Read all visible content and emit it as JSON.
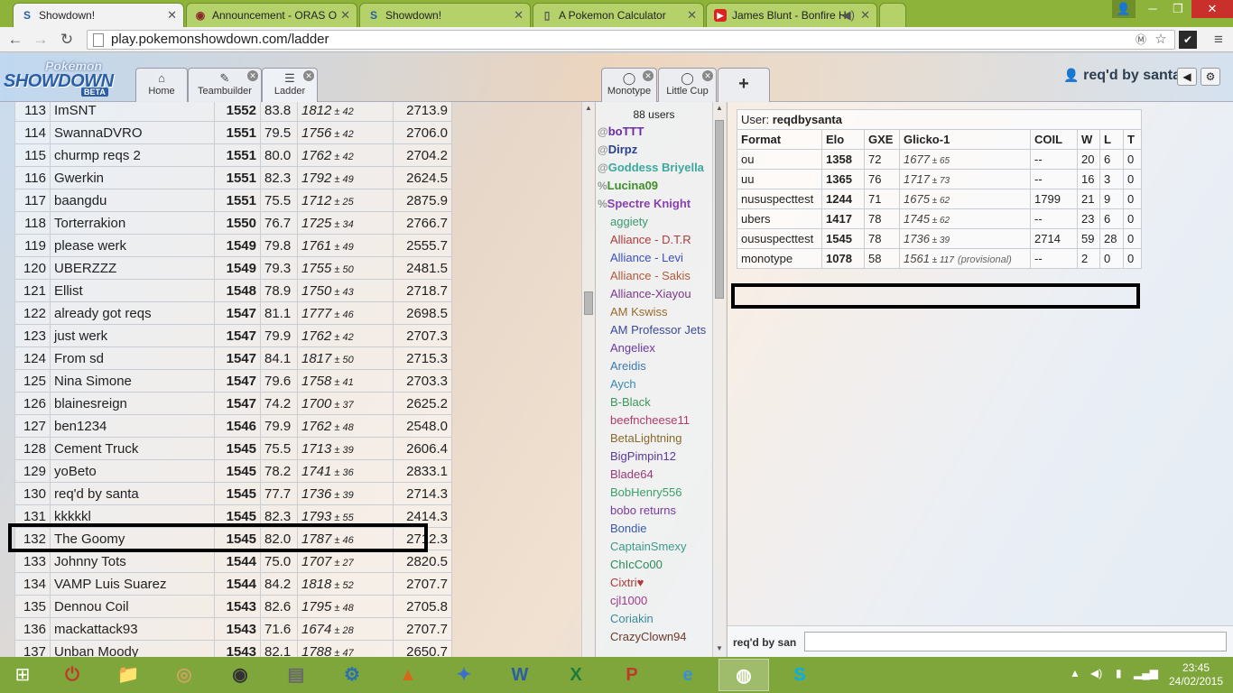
{
  "browser": {
    "tabs": [
      {
        "title": "Showdown!",
        "icon": "S",
        "icon_name": "showdown-favicon"
      },
      {
        "title": "Announcement - ORAS O",
        "icon": "◉",
        "icon_name": "smogon-favicon"
      },
      {
        "title": "Showdown!",
        "icon": "S",
        "icon_name": "showdown-favicon"
      },
      {
        "title": "A Pokemon Calculator",
        "icon": "▯",
        "icon_name": "page-favicon"
      },
      {
        "title": "James Blunt - Bonfire H",
        "icon": "▶",
        "icon_name": "youtube-favicon"
      }
    ],
    "url": "play.pokemonshowdown.com/ladder"
  },
  "showdown": {
    "logo_top": "Pokémon",
    "logo_main": "SHOWDOWN",
    "logo_badge": "BETA",
    "tabs": [
      {
        "label": "Home",
        "icon": "⌂"
      },
      {
        "label": "Teambuilder",
        "icon": "✎"
      },
      {
        "label": "Ladder",
        "icon": "☰"
      }
    ],
    "room_tabs": [
      {
        "label": "Monotype",
        "icon": "💬"
      },
      {
        "label": "Little Cup",
        "icon": "💬"
      },
      {
        "label": "+"
      }
    ],
    "username": "req'd by santa"
  },
  "ladder": {
    "partial_row": {
      "rank": "113",
      "name": "ImSNT",
      "elo": "1552",
      "gxe": "83.8",
      "glicko": "1812",
      "dev": "42",
      "coil": "2713.9"
    },
    "rows": [
      {
        "rank": "114",
        "name": "SwannaDVRO",
        "elo": "1551",
        "gxe": "79.5",
        "glicko": "1756",
        "dev": "42",
        "coil": "2706.0"
      },
      {
        "rank": "115",
        "name": "churmp reqs 2",
        "elo": "1551",
        "gxe": "80.0",
        "glicko": "1762",
        "dev": "42",
        "coil": "2704.2"
      },
      {
        "rank": "116",
        "name": "Gwerkin",
        "elo": "1551",
        "gxe": "82.3",
        "glicko": "1792",
        "dev": "49",
        "coil": "2624.5"
      },
      {
        "rank": "117",
        "name": "baangdu",
        "elo": "1551",
        "gxe": "75.5",
        "glicko": "1712",
        "dev": "25",
        "coil": "2875.9"
      },
      {
        "rank": "118",
        "name": "Torterrakion",
        "elo": "1550",
        "gxe": "76.7",
        "glicko": "1725",
        "dev": "34",
        "coil": "2766.7"
      },
      {
        "rank": "119",
        "name": "please werk",
        "elo": "1549",
        "gxe": "79.8",
        "glicko": "1761",
        "dev": "49",
        "coil": "2555.7"
      },
      {
        "rank": "120",
        "name": "UBERZZZ",
        "elo": "1549",
        "gxe": "79.3",
        "glicko": "1755",
        "dev": "50",
        "coil": "2481.5"
      },
      {
        "rank": "121",
        "name": "Ellist",
        "elo": "1548",
        "gxe": "78.9",
        "glicko": "1750",
        "dev": "43",
        "coil": "2718.7"
      },
      {
        "rank": "122",
        "name": "already got reqs",
        "elo": "1547",
        "gxe": "81.1",
        "glicko": "1777",
        "dev": "46",
        "coil": "2698.5"
      },
      {
        "rank": "123",
        "name": "just werk",
        "elo": "1547",
        "gxe": "79.9",
        "glicko": "1762",
        "dev": "42",
        "coil": "2707.3"
      },
      {
        "rank": "124",
        "name": "From sd",
        "elo": "1547",
        "gxe": "84.1",
        "glicko": "1817",
        "dev": "50",
        "coil": "2715.3"
      },
      {
        "rank": "125",
        "name": "Nina Simone",
        "elo": "1547",
        "gxe": "79.6",
        "glicko": "1758",
        "dev": "41",
        "coil": "2703.3"
      },
      {
        "rank": "126",
        "name": "blainesreign",
        "elo": "1547",
        "gxe": "74.2",
        "glicko": "1700",
        "dev": "37",
        "coil": "2625.2"
      },
      {
        "rank": "127",
        "name": "ben1234",
        "elo": "1546",
        "gxe": "79.9",
        "glicko": "1762",
        "dev": "48",
        "coil": "2548.0"
      },
      {
        "rank": "128",
        "name": "Cement Truck",
        "elo": "1545",
        "gxe": "75.5",
        "glicko": "1713",
        "dev": "39",
        "coil": "2606.4"
      },
      {
        "rank": "129",
        "name": "yoBeto",
        "elo": "1545",
        "gxe": "78.2",
        "glicko": "1741",
        "dev": "36",
        "coil": "2833.1"
      },
      {
        "rank": "130",
        "name": "req'd by santa",
        "elo": "1545",
        "gxe": "77.7",
        "glicko": "1736",
        "dev": "39",
        "coil": "2714.3"
      },
      {
        "rank": "131",
        "name": "kkkkkl",
        "elo": "1545",
        "gxe": "82.3",
        "glicko": "1793",
        "dev": "55",
        "coil": "2414.3"
      },
      {
        "rank": "132",
        "name": "The Goomy",
        "elo": "1545",
        "gxe": "82.0",
        "glicko": "1787",
        "dev": "46",
        "coil": "2712.3"
      },
      {
        "rank": "133",
        "name": "Johnny Tots",
        "elo": "1544",
        "gxe": "75.0",
        "glicko": "1707",
        "dev": "27",
        "coil": "2820.5"
      },
      {
        "rank": "134",
        "name": "VAMP Luis Suarez",
        "elo": "1544",
        "gxe": "84.2",
        "glicko": "1818",
        "dev": "52",
        "coil": "2707.7"
      },
      {
        "rank": "135",
        "name": "Dennou Coil",
        "elo": "1543",
        "gxe": "82.6",
        "glicko": "1795",
        "dev": "48",
        "coil": "2705.8"
      },
      {
        "rank": "136",
        "name": "mackattack93",
        "elo": "1543",
        "gxe": "71.6",
        "glicko": "1674",
        "dev": "28",
        "coil": "2707.7"
      },
      {
        "rank": "137",
        "name": "Unban Moody",
        "elo": "1543",
        "gxe": "82.1",
        "glicko": "1788",
        "dev": "47",
        "coil": "2650.7"
      }
    ]
  },
  "userlist": {
    "count": "88 users",
    "users": [
      {
        "rank": "@",
        "name": "boTTT",
        "color": "#6b2ca8"
      },
      {
        "rank": "@",
        "name": "Dirpz",
        "color": "#2a3f8f"
      },
      {
        "rank": "@",
        "name": "Goddess Briyella",
        "color": "#3aa8a0"
      },
      {
        "rank": "%",
        "name": "Lucina09",
        "color": "#3f8f2a"
      },
      {
        "rank": "%",
        "name": "Spectre Knight",
        "color": "#8a3fb0"
      },
      {
        "rank": "",
        "name": "aggiety",
        "color": "#3a9a6f"
      },
      {
        "rank": "",
        "name": "Alliance - D.T.R",
        "color": "#b03a3a"
      },
      {
        "rank": "",
        "name": "Alliance - Levi",
        "color": "#3a4fbf"
      },
      {
        "rank": "",
        "name": "Alliance - Sakis",
        "color": "#b05a3a"
      },
      {
        "rank": "",
        "name": "Alliance-Xiayou",
        "color": "#7a3a8a"
      },
      {
        "rank": "",
        "name": "AM Kswiss",
        "color": "#9a6a2a"
      },
      {
        "rank": "",
        "name": "AM Professor Jets",
        "color": "#3a4a9a"
      },
      {
        "rank": "",
        "name": "Angeliex",
        "color": "#6a3aa0"
      },
      {
        "rank": "",
        "name": "Areidis",
        "color": "#3a7ab0"
      },
      {
        "rank": "",
        "name": "Aych",
        "color": "#3a8ab0"
      },
      {
        "rank": "",
        "name": "B-Black",
        "color": "#3a9a5a"
      },
      {
        "rank": "",
        "name": "beefncheese11",
        "color": "#b03a6a"
      },
      {
        "rank": "",
        "name": "BetaLightning",
        "color": "#8a6a2a"
      },
      {
        "rank": "",
        "name": "BigPimpin12",
        "color": "#5a3a9a"
      },
      {
        "rank": "",
        "name": "Blade64",
        "color": "#9a3a7a"
      },
      {
        "rank": "",
        "name": "BobHenry556",
        "color": "#3aa06a"
      },
      {
        "rank": "",
        "name": "bobo returns",
        "color": "#7a3aa0"
      },
      {
        "rank": "",
        "name": "Bondie",
        "color": "#3a5ab0"
      },
      {
        "rank": "",
        "name": "CaptainSmexy",
        "color": "#3a9a8a"
      },
      {
        "rank": "",
        "name": "ChIcCo00",
        "color": "#2a8a5a"
      },
      {
        "rank": "",
        "name": "Cixtri♥",
        "color": "#b03a3a"
      },
      {
        "rank": "",
        "name": "cjl1000",
        "color": "#a03a8a"
      },
      {
        "rank": "",
        "name": "Coriakin",
        "color": "#3a8a9a"
      },
      {
        "rank": "",
        "name": "CrazyClown94",
        "color": "#6a3a2a"
      }
    ]
  },
  "userinfo": {
    "label": "User:",
    "username": "reqdbysanta",
    "headers": [
      "Format",
      "Elo",
      "GXE",
      "Glicko-1",
      "COIL",
      "W",
      "L",
      "T"
    ],
    "rows": [
      {
        "format": "ou",
        "elo": "1358",
        "gxe": "72",
        "glicko": "1677",
        "dev": "65",
        "note": "",
        "coil": "--",
        "w": "20",
        "l": "6",
        "t": "0"
      },
      {
        "format": "uu",
        "elo": "1365",
        "gxe": "76",
        "glicko": "1717",
        "dev": "73",
        "note": "",
        "coil": "--",
        "w": "16",
        "l": "3",
        "t": "0"
      },
      {
        "format": "nususpecttest",
        "elo": "1244",
        "gxe": "71",
        "glicko": "1675",
        "dev": "62",
        "note": "",
        "coil": "1799",
        "w": "21",
        "l": "9",
        "t": "0"
      },
      {
        "format": "ubers",
        "elo": "1417",
        "gxe": "78",
        "glicko": "1745",
        "dev": "62",
        "note": "",
        "coil": "--",
        "w": "23",
        "l": "6",
        "t": "0"
      },
      {
        "format": "oususpecttest",
        "elo": "1545",
        "gxe": "78",
        "glicko": "1736",
        "dev": "39",
        "note": "",
        "coil": "2714",
        "w": "59",
        "l": "28",
        "t": "0"
      },
      {
        "format": "monotype",
        "elo": "1078",
        "gxe": "58",
        "glicko": "1561",
        "dev": "117",
        "note": "(provisional)",
        "coil": "--",
        "w": "2",
        "l": "0",
        "t": "0"
      }
    ]
  },
  "chat": {
    "name": "req'd by san",
    "input_value": ""
  },
  "taskbar": {
    "time": "23:45",
    "date": "24/02/2015",
    "apps": [
      {
        "icon": "⏻",
        "name": "power-app-icon"
      },
      {
        "icon": "📁",
        "name": "file-explorer-icon"
      },
      {
        "icon": "◎",
        "name": "disc-app-icon"
      },
      {
        "icon": "◉",
        "name": "speaker-app-icon"
      },
      {
        "icon": "▤",
        "name": "document-app-icon"
      },
      {
        "icon": "⚙",
        "name": "settings-app-icon"
      },
      {
        "icon": "▲",
        "name": "matlab-icon"
      },
      {
        "icon": "✦",
        "name": "wing-app-icon"
      },
      {
        "icon": "W",
        "name": "word-icon"
      },
      {
        "icon": "X",
        "name": "excel-icon"
      },
      {
        "icon": "P",
        "name": "powerpoint-icon"
      },
      {
        "icon": "e",
        "name": "internet-explorer-icon"
      },
      {
        "icon": "◍",
        "name": "chrome-icon"
      },
      {
        "icon": "S",
        "name": "skype-icon"
      }
    ]
  }
}
